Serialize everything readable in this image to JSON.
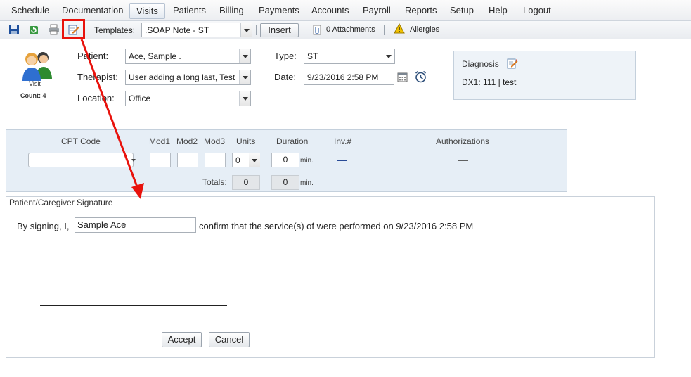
{
  "menu": [
    "Schedule",
    "Documentation",
    "Visits",
    "Patients",
    "Billing",
    "Payments",
    "Accounts",
    "Payroll",
    "Reports",
    "Setup",
    "Help",
    "Logout"
  ],
  "toolbar": {
    "templates_label": "Templates:",
    "template_value": ".SOAP Note - ST",
    "insert_label": "Insert",
    "attachments_label": "0 Attachments",
    "allergies_label": "Allergies"
  },
  "visit": {
    "label": "Visit",
    "count": "Count: 4"
  },
  "form": {
    "patient_label": "Patient:",
    "patient_value": "Ace, Sample  .",
    "therapist_label": "Therapist:",
    "therapist_value": "User adding a long last, Test",
    "location_label": "Location:",
    "location_value": "Office",
    "type_label": "Type:",
    "type_value": "ST",
    "date_label": "Date:",
    "date_value": "9/23/2016 2:58 PM"
  },
  "diagnosis": {
    "title": "Diagnosis",
    "dx1": "DX1: 111 | test"
  },
  "cpt": {
    "headers": {
      "cpt_code": "CPT Code",
      "mod1": "Mod1",
      "mod2": "Mod2",
      "mod3": "Mod3",
      "units": "Units",
      "duration": "Duration",
      "inv": "Inv.#",
      "authorizations": "Authorizations"
    },
    "units_value": "0",
    "duration_value": "0",
    "min_label": "min.",
    "inv_value": "—",
    "auth_value": "—",
    "totals_label": "Totals:",
    "totals_units": "0",
    "totals_duration": "0"
  },
  "signature": {
    "title": "Patient/Caregiver Signature",
    "prefix": "By signing, I,",
    "name_value": "Sample Ace",
    "suffix": "confirm that the service(s) of were performed on 9/23/2016 2:58 PM",
    "accept_label": "Accept",
    "cancel_label": "Cancel"
  },
  "colors": {
    "highlight": "#e8120c",
    "panel_bg": "#e6eef6",
    "link_blue": "#1a3d8f"
  }
}
